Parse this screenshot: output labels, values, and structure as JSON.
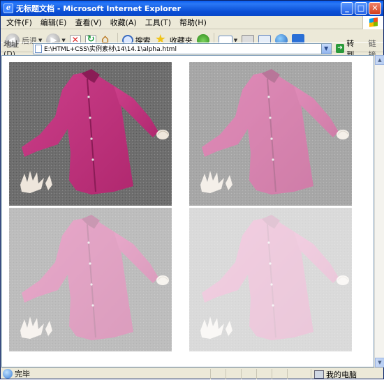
{
  "window": {
    "title": "无标题文档 - Microsoft Internet Explorer",
    "buttons": {
      "minimize": "_",
      "maximize": "□",
      "close": "✕"
    }
  },
  "menubar": {
    "items": [
      "文件(F)",
      "编辑(E)",
      "查看(V)",
      "收藏(A)",
      "工具(T)",
      "帮助(H)"
    ]
  },
  "toolbar": {
    "back_label": "后退",
    "search_label": "搜索",
    "favorites_label": "收藏夹"
  },
  "addressbar": {
    "label": "地址(D)",
    "value": "E:\\HTML+CSS\\实例素材\\14\\14.1\\alpha.html",
    "go_label": "转到",
    "links_label": "链接"
  },
  "content": {
    "photos": [
      {
        "name": "shirt-opacity-100",
        "opacity": 1.0
      },
      {
        "name": "shirt-opacity-75",
        "opacity": 0.6
      },
      {
        "name": "shirt-opacity-50",
        "opacity": 0.45
      },
      {
        "name": "shirt-opacity-25",
        "opacity": 0.25
      }
    ],
    "colors": {
      "shirt": "#b0286f",
      "floor": "#6e6e6e"
    }
  },
  "statusbar": {
    "text": "完毕",
    "zone": "我的电脑"
  }
}
